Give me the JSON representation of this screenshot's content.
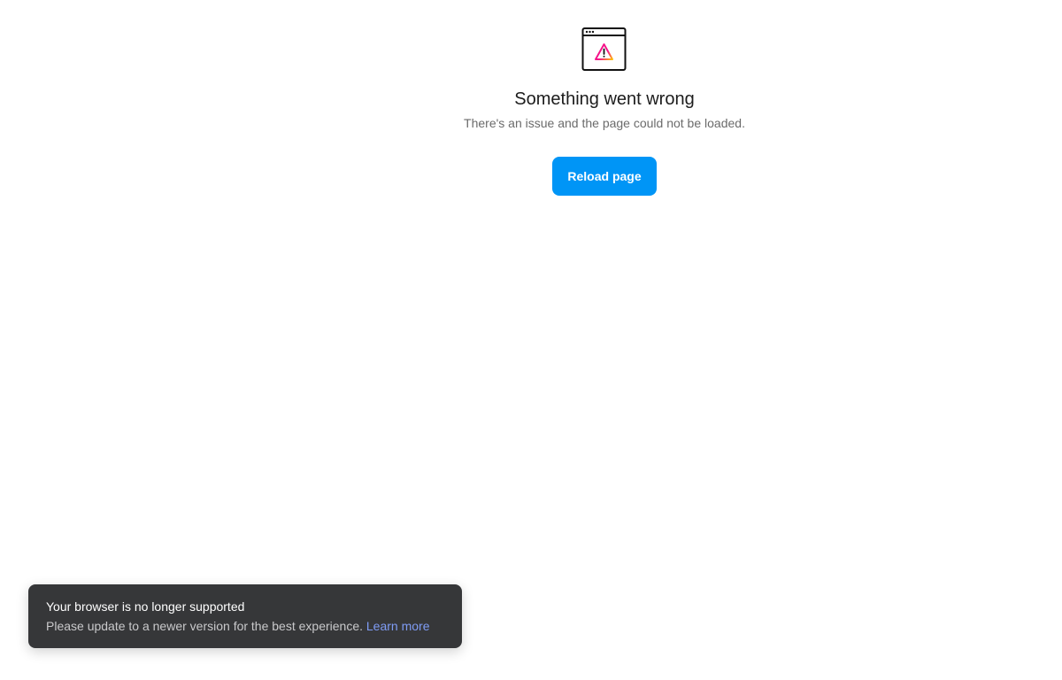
{
  "error": {
    "icon": "browser-warning-icon",
    "title": "Something went wrong",
    "message": "There's an issue and the page could not be loaded.",
    "reload_label": "Reload page"
  },
  "toast": {
    "title": "Your browser is no longer supported",
    "body": "Please update to a newer version for the best experience.",
    "link_label": "Learn more"
  },
  "colors": {
    "button": "#0095f6",
    "toast_background": "#363739",
    "link": "#7f9cf5"
  }
}
